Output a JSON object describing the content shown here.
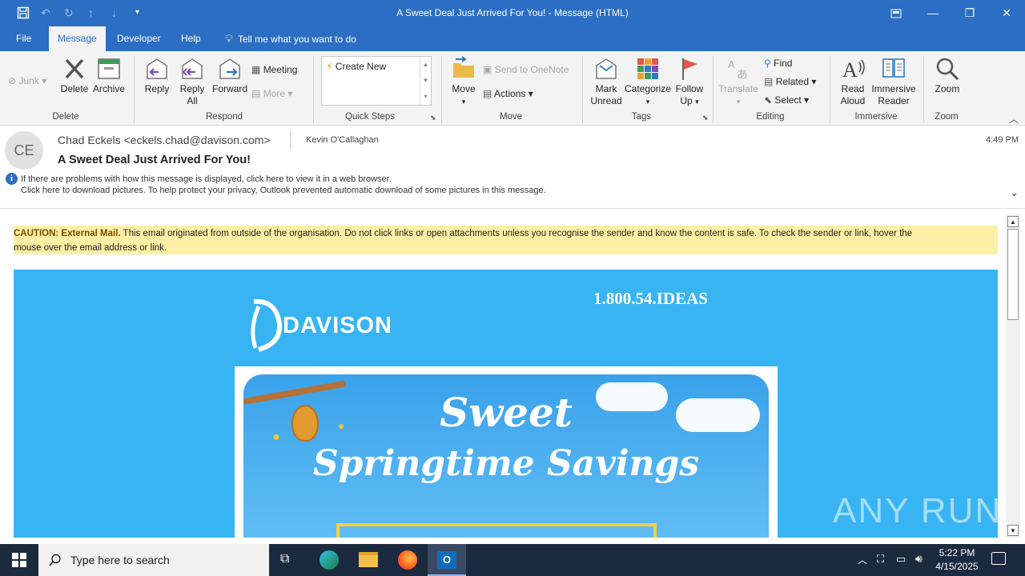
{
  "titlebar": {
    "title": "A Sweet Deal Just Arrived For You!  -  Message (HTML)"
  },
  "tabs": [
    {
      "label": "File"
    },
    {
      "label": "Message"
    },
    {
      "label": "Developer"
    },
    {
      "label": "Help"
    }
  ],
  "tell_me": "Tell me what you want to do",
  "ribbon": {
    "delete_group": {
      "label": "Delete",
      "junk": "Junk",
      "delete": "Delete",
      "archive": "Archive"
    },
    "respond_group": {
      "label": "Respond",
      "reply": "Reply",
      "reply_all_1": "Reply",
      "reply_all_2": "All",
      "forward": "Forward",
      "meeting": "Meeting",
      "more": "More"
    },
    "quick_steps_group": {
      "label": "Quick Steps",
      "create_new": "Create New"
    },
    "move_group": {
      "label": "Move",
      "move": "Move",
      "onenote": "Send to OneNote",
      "actions": "Actions"
    },
    "tags_group": {
      "label": "Tags",
      "mark_unread_1": "Mark",
      "mark_unread_2": "Unread",
      "categorize": "Categorize",
      "follow_up_1": "Follow",
      "follow_up_2": "Up"
    },
    "editing_group": {
      "label": "Editing",
      "translate": "Translate",
      "find": "Find",
      "related": "Related",
      "select": "Select"
    },
    "immersive_group": {
      "label": "Immersive",
      "read_aloud_1": "Read",
      "read_aloud_2": "Aloud",
      "immersive_reader_1": "Immersive",
      "immersive_reader_2": "Reader"
    },
    "zoom_group": {
      "label": "Zoom",
      "zoom": "Zoom"
    }
  },
  "message": {
    "avatar_initials": "CE",
    "from": "Chad Eckels <eckels.chad@davison.com>",
    "to": "Kevin O'Callaghan",
    "time": "4:49 PM",
    "subject": "A Sweet Deal Just Arrived For You!",
    "info_line_1": "If there are problems with how this message is displayed, click here to view it in a web browser.",
    "info_line_2": "Click here to download pictures. To help protect your privacy, Outlook prevented automatic download of some pictures in this message."
  },
  "email_body": {
    "caution_bold": "CAUTION: External Mail.",
    "caution_text_1": " This email originated from outside of the organisation. Do not click links or open attachments unless you recognise the sender and know the content is safe. To check the sender or link, hover the",
    "caution_text_2": "mouse over the email address or link.",
    "phone": "1.800.54.IDEAS",
    "brand": "DAVISON",
    "banner_line_1": "Sweet",
    "banner_line_2": "Springtime Savings"
  },
  "watermark": "ANY RUN",
  "taskbar": {
    "search_placeholder": "Type here to search",
    "time": "5:22 PM",
    "date": "4/15/2025"
  },
  "colors": {
    "accent": "#2b6ec3",
    "caution_bg": "#fdf0a6",
    "hero_bg": "#38b4f2",
    "taskbar_bg": "#1b2a3f"
  }
}
